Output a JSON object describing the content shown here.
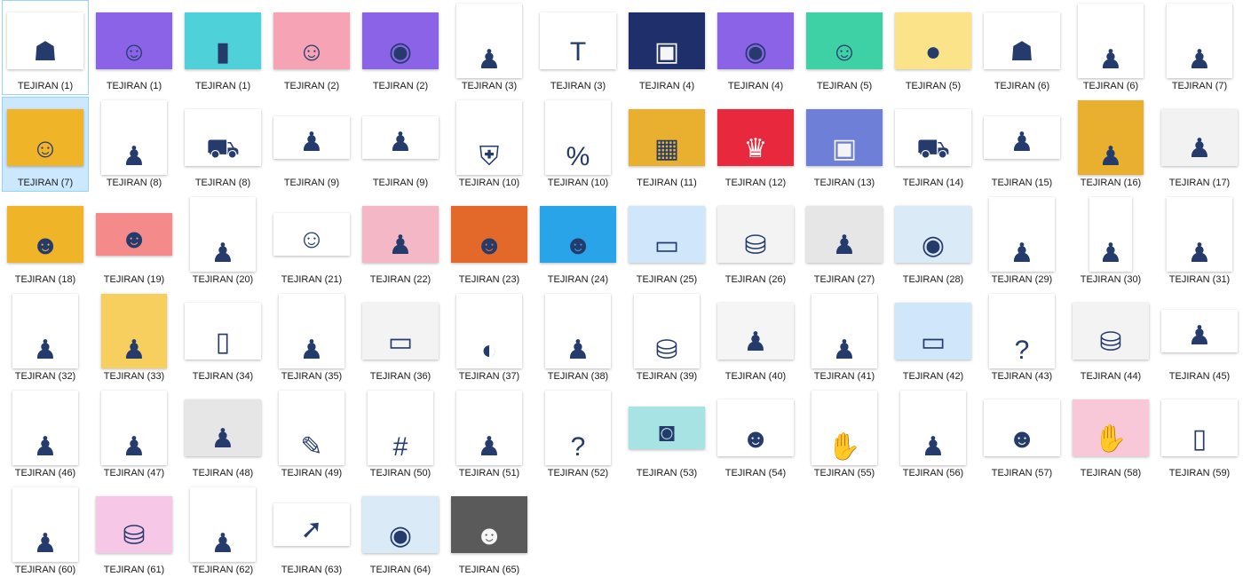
{
  "items": [
    {
      "name": "TEJIRAN (1)",
      "shape": "land",
      "bg": "#ffffff",
      "icon": "stairs-people-icon",
      "glyph": "☗",
      "selected": false,
      "focused": true
    },
    {
      "name": "TEJIRAN (1)",
      "shape": "land",
      "bg": "#8b63e6",
      "icon": "person-laptop-icon",
      "glyph": "☺"
    },
    {
      "name": "TEJIRAN (1)",
      "shape": "land",
      "bg": "#4fd1d9",
      "icon": "paper-stack-icon",
      "glyph": "▮"
    },
    {
      "name": "TEJIRAN (2)",
      "shape": "land",
      "bg": "#f5a3b5",
      "icon": "woman-thinking-icon",
      "glyph": "☺"
    },
    {
      "name": "TEJIRAN (2)",
      "shape": "land",
      "bg": "#8b63e6",
      "icon": "armchair-clock-icon",
      "glyph": "◉"
    },
    {
      "name": "TEJIRAN (3)",
      "shape": "port",
      "bg": "#ffffff",
      "icon": "man-location-pin-icon",
      "glyph": "♟"
    },
    {
      "name": "TEJIRAN (3)",
      "shape": "land",
      "bg": "#ffffff",
      "icon": "team-letters-icon",
      "glyph": "T"
    },
    {
      "name": "TEJIRAN (4)",
      "shape": "land",
      "bg": "#1e2f6b",
      "icon": "man-desk-monitor-icon",
      "glyph": "▣",
      "light": true
    },
    {
      "name": "TEJIRAN (4)",
      "shape": "land",
      "bg": "#8b63e6",
      "icon": "armchair-clock-icon",
      "glyph": "◉"
    },
    {
      "name": "TEJIRAN (5)",
      "shape": "land",
      "bg": "#3ed1a6",
      "icon": "man-phone-icon",
      "glyph": "☺"
    },
    {
      "name": "TEJIRAN (5)",
      "shape": "land",
      "bg": "#fbe38a",
      "icon": "woman-megaphone-icon",
      "glyph": "●"
    },
    {
      "name": "TEJIRAN (6)",
      "shape": "land",
      "bg": "#ffffff",
      "icon": "stairs-people-icon",
      "glyph": "☗"
    },
    {
      "name": "TEJIRAN (6)",
      "shape": "port",
      "bg": "#ffffff",
      "icon": "man-speech-bubble-icon",
      "glyph": "♟"
    },
    {
      "name": "TEJIRAN (7)",
      "shape": "port",
      "bg": "#ffffff",
      "icon": "man-holding-card-icon",
      "glyph": "♟"
    },
    {
      "name": "TEJIRAN (7)",
      "shape": "land",
      "bg": "#f0b429",
      "icon": "man-red-hoodie-icon",
      "glyph": "☺",
      "selected": true
    },
    {
      "name": "TEJIRAN (8)",
      "shape": "port",
      "bg": "#ffffff",
      "icon": "man-phone-call-icon",
      "glyph": "♟"
    },
    {
      "name": "TEJIRAN (8)",
      "shape": "land",
      "bg": "#ffffff",
      "icon": "delivery-scooter-icon",
      "glyph": "⛟"
    },
    {
      "name": "TEJIRAN (9)",
      "shape": "wide",
      "bg": "#ffffff",
      "icon": "business-team-icon",
      "glyph": "♟"
    },
    {
      "name": "TEJIRAN (9)",
      "shape": "wide",
      "bg": "#ffffff",
      "icon": "man-sitting-plant-icon",
      "glyph": "♟"
    },
    {
      "name": "TEJIRAN (10)",
      "shape": "port",
      "bg": "#ffffff",
      "icon": "man-shield-icon",
      "glyph": "⛨"
    },
    {
      "name": "TEJIRAN (10)",
      "shape": "port",
      "bg": "#ffffff",
      "icon": "man-percent-sign-icon",
      "glyph": "%"
    },
    {
      "name": "TEJIRAN (11)",
      "shape": "land",
      "bg": "#e8b02e",
      "icon": "man-collage-icon",
      "glyph": "▦"
    },
    {
      "name": "TEJIRAN (12)",
      "shape": "land",
      "bg": "#e8283c",
      "icon": "trophy-icon",
      "glyph": "♛",
      "light": true
    },
    {
      "name": "TEJIRAN (13)",
      "shape": "land",
      "bg": "#6d7fd6",
      "icon": "woman-office-desk-icon",
      "glyph": "▣",
      "light": true
    },
    {
      "name": "TEJIRAN (14)",
      "shape": "land",
      "bg": "#ffffff",
      "icon": "delivery-scooter-icon",
      "glyph": "⛟"
    },
    {
      "name": "TEJIRAN (15)",
      "shape": "wide",
      "bg": "#ffffff",
      "icon": "man-sitting-plant-icon",
      "glyph": "♟"
    },
    {
      "name": "TEJIRAN (16)",
      "shape": "port",
      "bg": "#e8b02e",
      "icon": "man-sitting-chair-icon",
      "glyph": "♟"
    },
    {
      "name": "TEJIRAN (17)",
      "shape": "land",
      "bg": "#f2f2f2",
      "icon": "woman-room-icon",
      "glyph": "♟"
    },
    {
      "name": "TEJIRAN (18)",
      "shape": "land",
      "bg": "#f0b429",
      "icon": "bearded-man-portrait-icon",
      "glyph": "☻"
    },
    {
      "name": "TEJIRAN (19)",
      "shape": "wide",
      "bg": "#f58a8a",
      "icon": "man-red-cap-icon",
      "glyph": "☻"
    },
    {
      "name": "TEJIRAN (20)",
      "shape": "port",
      "bg": "#ffffff",
      "icon": "man-ideas-icon",
      "glyph": "♟"
    },
    {
      "name": "TEJIRAN (21)",
      "shape": "wide",
      "bg": "#ffffff",
      "icon": "woman-yoga-icon",
      "glyph": "☺"
    },
    {
      "name": "TEJIRAN (22)",
      "shape": "land",
      "bg": "#f4b7c5",
      "icon": "group-people-icon",
      "glyph": "♟"
    },
    {
      "name": "TEJIRAN (23)",
      "shape": "land",
      "bg": "#e3692a",
      "icon": "man-portrait-orange-icon",
      "glyph": "☻"
    },
    {
      "name": "TEJIRAN (24)",
      "shape": "land",
      "bg": "#2aa4e8",
      "icon": "group-friends-icon",
      "glyph": "☻"
    },
    {
      "name": "TEJIRAN (25)",
      "shape": "land",
      "bg": "#cfe6fb",
      "icon": "man-on-board-icon",
      "glyph": "▭"
    },
    {
      "name": "TEJIRAN (26)",
      "shape": "land",
      "bg": "#f3f3f3",
      "icon": "man-on-coins-icon",
      "glyph": "⛁"
    },
    {
      "name": "TEJIRAN (27)",
      "shape": "land",
      "bg": "#e6e6e6",
      "icon": "man-running-icon",
      "glyph": "♟"
    },
    {
      "name": "TEJIRAN (28)",
      "shape": "land",
      "bg": "#dbeaf7",
      "icon": "armchair-clock-icon",
      "glyph": "◉"
    },
    {
      "name": "TEJIRAN (29)",
      "shape": "port",
      "bg": "#ffffff",
      "icon": "man-piggy-bank-icon",
      "glyph": "♟"
    },
    {
      "name": "TEJIRAN (30)",
      "shape": "slim",
      "bg": "#ffffff",
      "icon": "man-floating-ideas-icon",
      "glyph": "♟"
    },
    {
      "name": "TEJIRAN (31)",
      "shape": "port",
      "bg": "#ffffff",
      "icon": "man-safe-icon",
      "glyph": "♟"
    },
    {
      "name": "TEJIRAN (32)",
      "shape": "port",
      "bg": "#ffffff",
      "icon": "man-speech-bubble-icon",
      "glyph": "♟"
    },
    {
      "name": "TEJIRAN (33)",
      "shape": "port",
      "bg": "#f7cf5e",
      "icon": "man-red-cape-icon",
      "glyph": "♟"
    },
    {
      "name": "TEJIRAN (34)",
      "shape": "land",
      "bg": "#ffffff",
      "icon": "hand-smartphone-icon",
      "glyph": "▯"
    },
    {
      "name": "TEJIRAN (35)",
      "shape": "port",
      "bg": "#ffffff",
      "icon": "man-location-pin-icon",
      "glyph": "♟"
    },
    {
      "name": "TEJIRAN (36)",
      "shape": "land",
      "bg": "#f3f3f3",
      "icon": "man-on-board-icon",
      "glyph": "▭"
    },
    {
      "name": "TEJIRAN (37)",
      "shape": "port",
      "bg": "#ffffff",
      "icon": "man-egg-chair-icon",
      "glyph": "◐"
    },
    {
      "name": "TEJIRAN (38)",
      "shape": "port",
      "bg": "#ffffff",
      "icon": "man-vr-headset-icon",
      "glyph": "♟"
    },
    {
      "name": "TEJIRAN (39)",
      "shape": "port",
      "bg": "#ffffff",
      "icon": "man-growth-chart-icon",
      "glyph": "⛁"
    },
    {
      "name": "TEJIRAN (40)",
      "shape": "land",
      "bg": "#f5f5f5",
      "icon": "man-briefcase-icon",
      "glyph": "♟"
    },
    {
      "name": "TEJIRAN (41)",
      "shape": "port",
      "bg": "#ffffff",
      "icon": "woman-shopping-bag-icon",
      "glyph": "♟"
    },
    {
      "name": "TEJIRAN (42)",
      "shape": "land",
      "bg": "#cfe6fb",
      "icon": "man-on-board-icon",
      "glyph": "▭"
    },
    {
      "name": "TEJIRAN (43)",
      "shape": "port",
      "bg": "#ffffff",
      "icon": "question-mark-icon",
      "glyph": "?"
    },
    {
      "name": "TEJIRAN (44)",
      "shape": "land",
      "bg": "#f3f3f3",
      "icon": "man-on-coins-icon",
      "glyph": "⛁"
    },
    {
      "name": "TEJIRAN (45)",
      "shape": "wide",
      "bg": "#ffffff",
      "icon": "people-megaphone-icon",
      "glyph": "♟"
    },
    {
      "name": "TEJIRAN (46)",
      "shape": "port",
      "bg": "#ffffff",
      "icon": "man-megaphone-icon",
      "glyph": "♟"
    },
    {
      "name": "TEJIRAN (47)",
      "shape": "port",
      "bg": "#ffffff",
      "icon": "man-finish-line-icon",
      "glyph": "♟"
    },
    {
      "name": "TEJIRAN (48)",
      "shape": "land",
      "bg": "#e6e6e6",
      "icon": "man-running-icon",
      "glyph": "♟"
    },
    {
      "name": "TEJIRAN (49)",
      "shape": "port",
      "bg": "#ffffff",
      "icon": "man-pencil-icon",
      "glyph": "✎"
    },
    {
      "name": "TEJIRAN (50)",
      "shape": "port",
      "bg": "#ffffff",
      "icon": "man-hashtag-icon",
      "glyph": "#"
    },
    {
      "name": "TEJIRAN (51)",
      "shape": "port",
      "bg": "#ffffff",
      "icon": "man-pointing-icon",
      "glyph": "♟"
    },
    {
      "name": "TEJIRAN (52)",
      "shape": "port",
      "bg": "#ffffff",
      "icon": "man-question-mark-icon",
      "glyph": "?"
    },
    {
      "name": "TEJIRAN (53)",
      "shape": "wide",
      "bg": "#a8e3e3",
      "icon": "camera-icon",
      "glyph": "◙"
    },
    {
      "name": "TEJIRAN (54)",
      "shape": "land",
      "bg": "#ffffff",
      "icon": "yellow-monster-icon",
      "glyph": "☻"
    },
    {
      "name": "TEJIRAN (55)",
      "shape": "port",
      "bg": "#ffffff",
      "icon": "hand-social-icons-icon",
      "glyph": "✋"
    },
    {
      "name": "TEJIRAN (56)",
      "shape": "port",
      "bg": "#ffffff",
      "icon": "three-friends-icon",
      "glyph": "♟"
    },
    {
      "name": "TEJIRAN (57)",
      "shape": "land",
      "bg": "#ffffff",
      "icon": "blue-mug-character-icon",
      "glyph": "☻"
    },
    {
      "name": "TEJIRAN (58)",
      "shape": "land",
      "bg": "#f8c7d8",
      "icon": "clapping-hands-icon",
      "glyph": "✋"
    },
    {
      "name": "TEJIRAN (59)",
      "shape": "land",
      "bg": "#ffffff",
      "icon": "hand-smartphone-icon",
      "glyph": "▯"
    },
    {
      "name": "TEJIRAN (60)",
      "shape": "port",
      "bg": "#ffffff",
      "icon": "man-lightbulb-icon",
      "glyph": "♟"
    },
    {
      "name": "TEJIRAN (61)",
      "shape": "land",
      "bg": "#f6c7e6",
      "icon": "man-coin-stairs-icon",
      "glyph": "⛁"
    },
    {
      "name": "TEJIRAN (62)",
      "shape": "port",
      "bg": "#ffffff",
      "icon": "man-smartphone-icon",
      "glyph": "♟"
    },
    {
      "name": "TEJIRAN (63)",
      "shape": "wide",
      "bg": "#ffffff",
      "icon": "people-pushing-arrow-icon",
      "glyph": "➚"
    },
    {
      "name": "TEJIRAN (64)",
      "shape": "land",
      "bg": "#dbeaf7",
      "icon": "armchair-clock-icon",
      "glyph": "◉"
    },
    {
      "name": "TEJIRAN (65)",
      "shape": "land",
      "bg": "#5a5a5a",
      "icon": "man-portrait-grey-icon",
      "glyph": "☻",
      "light": true
    }
  ]
}
